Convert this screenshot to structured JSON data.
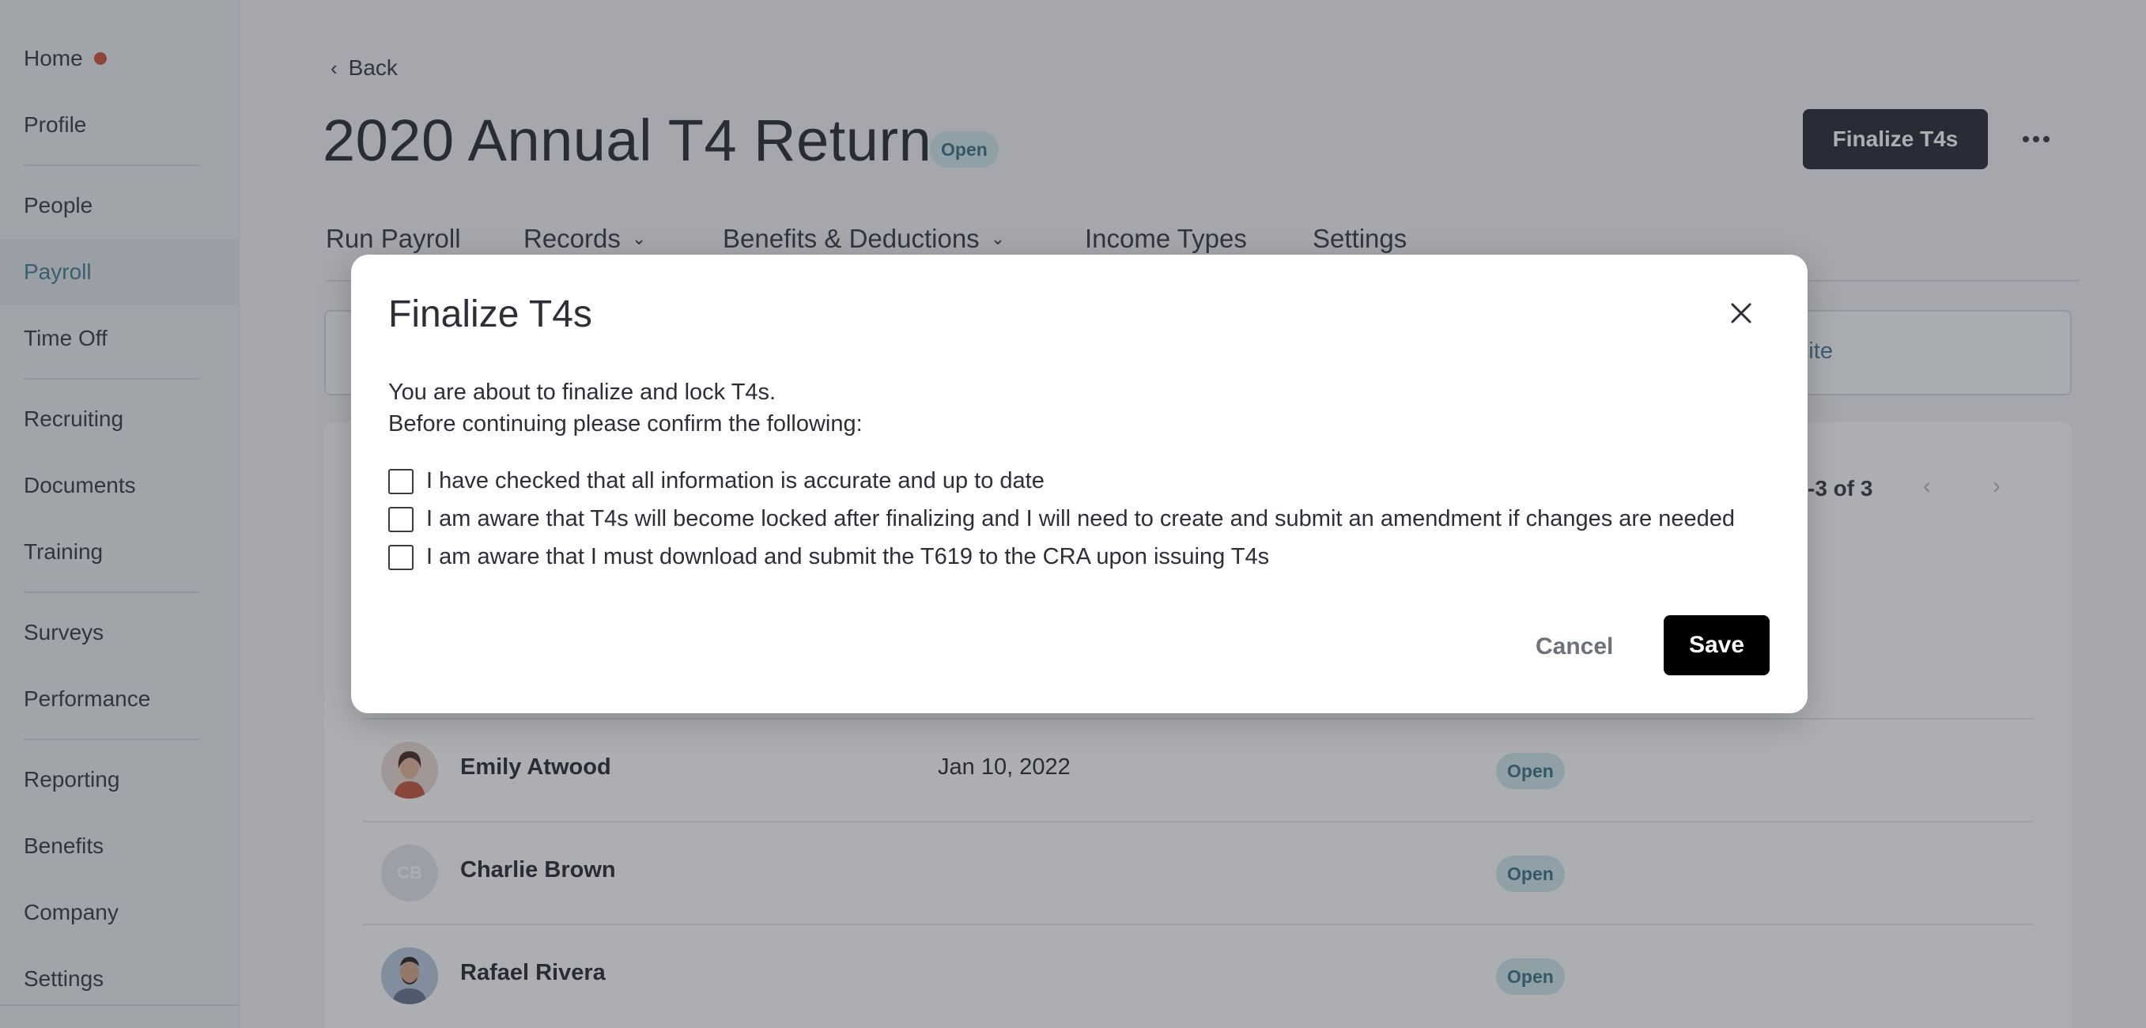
{
  "sidebar": {
    "items": [
      {
        "label": "Home"
      },
      {
        "label": "Profile"
      },
      {
        "label": "People"
      },
      {
        "label": "Payroll"
      },
      {
        "label": "Time Off"
      },
      {
        "label": "Recruiting"
      },
      {
        "label": "Documents"
      },
      {
        "label": "Training"
      },
      {
        "label": "Surveys"
      },
      {
        "label": "Performance"
      },
      {
        "label": "Reporting"
      },
      {
        "label": "Benefits"
      },
      {
        "label": "Company"
      },
      {
        "label": "Settings"
      }
    ],
    "active_item": "Payroll",
    "notification_color": "#d1543e"
  },
  "header": {
    "back_label": "Back",
    "title": "2020 Annual T4 Return",
    "status_badge": "Open",
    "finalize_label": "Finalize T4s",
    "more_icon": "more-horizontal-icon"
  },
  "tabs": [
    {
      "label": "Run Payroll"
    },
    {
      "label": "Records"
    },
    {
      "label": "Benefits & Deductions"
    },
    {
      "label": "Income Types"
    },
    {
      "label": "Settings"
    }
  ],
  "info_box": {
    "link_partial": "ebsite"
  },
  "table": {
    "pager_text": "-3 of 3",
    "rows": [
      {
        "name": "Emily Atwood",
        "date": "Jan 10, 2022",
        "status": "Open"
      },
      {
        "name": "Charlie Brown",
        "initials": "CB",
        "date": "",
        "status": "Open"
      },
      {
        "name": "Rafael Rivera",
        "date": "",
        "status": "Open"
      }
    ]
  },
  "modal": {
    "title": "Finalize T4s",
    "intro_line1": "You are about to finalize and lock T4s.",
    "intro_line2": "Before continuing please confirm the following:",
    "checks": [
      {
        "label": "I have checked that all information is accurate and up to date",
        "checked": false
      },
      {
        "label": "I am aware that T4s will become locked after finalizing and I will need to create and submit an amendment if changes are needed",
        "checked": false
      },
      {
        "label": "I am aware that I must download and submit the T619 to the CRA upon issuing T4s",
        "checked": false
      }
    ],
    "cancel_label": "Cancel",
    "save_label": "Save"
  },
  "colors": {
    "accent": "#4a7f92",
    "badge_bg": "#d2e9ee",
    "primary_button": "#2c2e38",
    "save_button": "#000000"
  }
}
